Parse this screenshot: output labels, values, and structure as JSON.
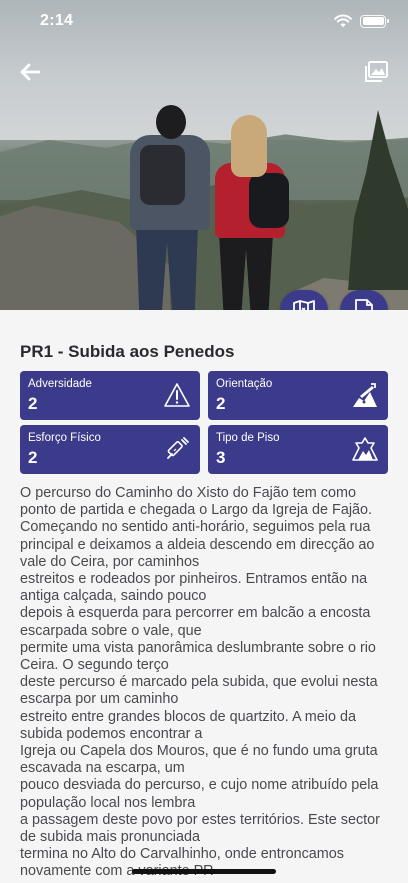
{
  "status_bar": {
    "time": "2:14"
  },
  "icons": {
    "back": "arrow-left-icon",
    "gallery": "photo-gallery-icon",
    "map": "folded-map-icon",
    "pdf": "pdf-document-icon"
  },
  "trail": {
    "title": "PR1 - Subida aos Penedos"
  },
  "stats": [
    {
      "label": "Adversidade",
      "value": "2",
      "icon": "warning-triangle-icon"
    },
    {
      "label": "Orientação",
      "value": "2",
      "icon": "signpost-icon"
    },
    {
      "label": "Esforço Físico",
      "value": "2",
      "icon": "syringe-effort-icon"
    },
    {
      "label": "Tipo de Piso",
      "value": "3",
      "icon": "terrain-ground-icon"
    }
  ],
  "description": "O percurso do Caminho do Xisto do Fajão tem como ponto de partida e chegada o Largo da Igreja de Fajão. Começando no sentido anti-horário, seguimos pela rua principal e deixamos a aldeia descendo em direcção ao vale do Ceira, por caminhos\nestreitos e rodeados por pinheiros. Entramos então na antiga calçada, saindo pouco\ndepois à esquerda para percorrer em balcão a encosta escarpada sobre o vale, que\npermite uma vista panorâmica deslumbrante sobre o rio Ceira. O segundo terço\ndeste percurso é marcado pela subida, que evolui nesta escarpa por um caminho\nestreito entre grandes blocos de quartzito. A meio da subida podemos encontrar a\nIgreja ou Capela dos Mouros, que é no fundo uma gruta escavada na escarpa, um\npouco desviada do percurso, e cujo nome atribuído pela população local nos lembra\na passagem deste povo por estes territórios. Este sector de subida mais pronunciada\ntermina no Alto do Carvalhinho, onde entroncamos novamente com a variante PR",
  "colors": {
    "accent": "#3c3a8a",
    "background": "#f5f5f6",
    "text": "#4a4a4e"
  }
}
